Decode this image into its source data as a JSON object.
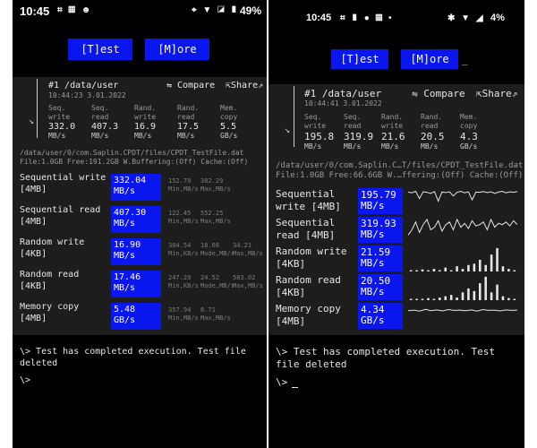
{
  "left": {
    "status": {
      "time": "10:45",
      "notif_icons": "⌗ ▦ ☻",
      "right_icons": "⌖ ▼ ◪ ▮",
      "battery": "49%"
    },
    "buttons": {
      "test": "[T]est",
      "more": "[M]ore"
    },
    "header": {
      "run": "#1 /data/user",
      "timestamp": "10:44:23 3.01.2022",
      "compare": "⇋ Compare",
      "share": "⇱Share⇗"
    },
    "summary": [
      {
        "l1": "Seq.",
        "l2": "write",
        "value": "332.0",
        "unit": "MB/s"
      },
      {
        "l1": "Seq.",
        "l2": "read",
        "value": "407.3",
        "unit": "MB/s"
      },
      {
        "l1": "Rand.",
        "l2": "write",
        "value": "16.9",
        "unit": "MB/s"
      },
      {
        "l1": "Rand.",
        "l2": "read",
        "value": "17.5",
        "unit": "MB/s"
      },
      {
        "l1": "Mem.",
        "l2": "copy",
        "value": "5.5",
        "unit": "GB/s"
      }
    ],
    "file_path": "/data/user/0/com.Saplin.CPDT/files/CPDT_TestFile.dat",
    "file_info": "File:1.0GB Free:191.2GB W.Buffering:(Off) Cache:(Off)",
    "rows": [
      {
        "name1": "Sequential write",
        "name2": "[4MB]",
        "value": "332.04",
        "unit": "MB/s",
        "s1": "152.79",
        "s1u": "Min,MB/s",
        "s2": "382.29",
        "s2u": "Max,MB/s",
        "s3": "",
        "s3u": ""
      },
      {
        "name1": "Sequential read",
        "name2": "[4MB]",
        "value": "407.30",
        "unit": "MB/s",
        "s1": "122.45",
        "s1u": "Min,MB/s",
        "s2": "552.25",
        "s2u": "Max,MB/s",
        "s3": "",
        "s3u": ""
      },
      {
        "name1": "Random write",
        "name2": "[4KB]",
        "value": "16.90",
        "unit": "MB/s",
        "s1": "304.54",
        "s1u": "Min,KB/s",
        "s2": "18.66",
        "s2u": "Mode,MB/s",
        "s3": "34.21",
        "s3u": "Max,MB/s"
      },
      {
        "name1": "Random read",
        "name2": "[4KB]",
        "value": "17.46",
        "unit": "MB/s",
        "s1": "247.29",
        "s1u": "Min,KB/s",
        "s2": "24.52",
        "s2u": "Mode,MB/s",
        "s3": "583.02",
        "s3u": "Max,MB/s"
      },
      {
        "name1": "Memory copy",
        "name2": "[4MB]",
        "value": "5.48",
        "unit": "GB/s",
        "s1": "357.94",
        "s1u": "Min,MB/s",
        "s2": "6.71",
        "s2u": "Max,MB/s",
        "s3": "",
        "s3u": ""
      }
    ],
    "terminal": {
      "line1": "\\> Test has completed execution. Test file",
      "line2": "deleted",
      "prompt": "\\>"
    }
  },
  "right": {
    "status": {
      "time": "10:45",
      "notif_icons": "⌗ ▮ ● ▦ •",
      "right_icons": "✱ ▼ ◢",
      "battery": "4%"
    },
    "buttons": {
      "test": "[T]est",
      "more": "[M]ore",
      "cursor": "_"
    },
    "header": {
      "run": "#1 /data/user",
      "timestamp": "10:44:41 3.01.2022",
      "compare": "⇋ Compare",
      "share": "⇱Share⇗"
    },
    "summary": [
      {
        "l1": "Seq.",
        "l2": "write",
        "value": "195.8",
        "unit": "MB/s"
      },
      {
        "l1": "Seq.",
        "l2": "read",
        "value": "319.9",
        "unit": "MB/s"
      },
      {
        "l1": "Rand.",
        "l2": "write",
        "value": "21.6",
        "unit": "MB/s"
      },
      {
        "l1": "Rand.",
        "l2": "read",
        "value": "20.5",
        "unit": "MB/s"
      },
      {
        "l1": "Mem.",
        "l2": "copy",
        "value": "4.3",
        "unit": "GB/s"
      }
    ],
    "file_path": "/data/user/0/com.Saplin.C…T/files/CPDT_TestFile.dat",
    "file_info": "File:1.0GB Free:66.6GB W.…ffering:(Off) Cache:(Off)",
    "rows": [
      {
        "name1": "Sequential",
        "name2": "write [4MB]",
        "value": "195.79",
        "unit": "MB/s"
      },
      {
        "name1": "Sequential",
        "name2": "read [4MB]",
        "value": "319.93",
        "unit": "MB/s"
      },
      {
        "name1": "Random write",
        "name2": "[4KB]",
        "value": "21.59",
        "unit": "MB/s"
      },
      {
        "name1": "Random read",
        "name2": "[4KB]",
        "value": "20.50",
        "unit": "MB/s"
      },
      {
        "name1": "Memory copy",
        "name2": "[4MB]",
        "value": "4.34",
        "unit": "GB/s"
      }
    ],
    "terminal": {
      "line1": "\\> Test has completed execution. Test",
      "line2": "file deleted",
      "prompt": "\\>"
    }
  },
  "colors": {
    "accent": "#0a16ee",
    "panel": "#1d1d1d",
    "background": "#000000"
  },
  "chart_data": [
    {
      "type": "line",
      "series": [
        {
          "values": [
            0.85,
            0.82,
            0.88,
            0.6,
            0.86,
            0.84,
            0.8,
            0.87,
            0.5,
            0.85,
            0.83,
            0.86,
            0.7,
            0.84,
            0.88,
            0.82,
            0.86,
            0.55,
            0.85,
            0.84,
            0.87,
            0.83,
            0.86,
            0.8,
            0.85,
            0.88,
            0.82,
            0.86,
            0.84,
            0.87
          ]
        }
      ]
    },
    {
      "type": "line",
      "series": [
        {
          "values": [
            0.3,
            0.5,
            0.8,
            0.4,
            0.7,
            0.9,
            0.5,
            0.6,
            0.85,
            0.45,
            0.7,
            0.8,
            0.5,
            0.9,
            0.6,
            0.75,
            0.55,
            0.85,
            0.65,
            0.7,
            0.8,
            0.5,
            0.9,
            0.6,
            0.75,
            0.7,
            0.8,
            0.65,
            0.85,
            0.7
          ]
        }
      ]
    },
    {
      "type": "bar",
      "values": [
        0.05,
        0.05,
        0.08,
        0.05,
        0.1,
        0.05,
        0.15,
        0.05,
        0.2,
        0.1,
        0.25,
        0.3,
        0.45,
        0.25,
        0.65,
        0.9,
        0.2,
        0.1,
        0.05
      ]
    },
    {
      "type": "bar",
      "values": [
        0.05,
        0.05,
        0.05,
        0.08,
        0.05,
        0.1,
        0.15,
        0.2,
        0.1,
        0.3,
        0.45,
        0.35,
        0.65,
        0.9,
        0.3,
        0.6,
        0.15,
        0.08,
        0.05
      ]
    },
    {
      "type": "line",
      "series": [
        {
          "values": [
            0.7,
            0.72,
            0.68,
            0.75,
            0.7,
            0.73,
            0.69,
            0.74,
            0.71,
            0.72,
            0.7,
            0.73,
            0.68,
            0.74,
            0.71,
            0.72,
            0.69,
            0.73,
            0.71,
            0.72
          ]
        }
      ]
    }
  ]
}
